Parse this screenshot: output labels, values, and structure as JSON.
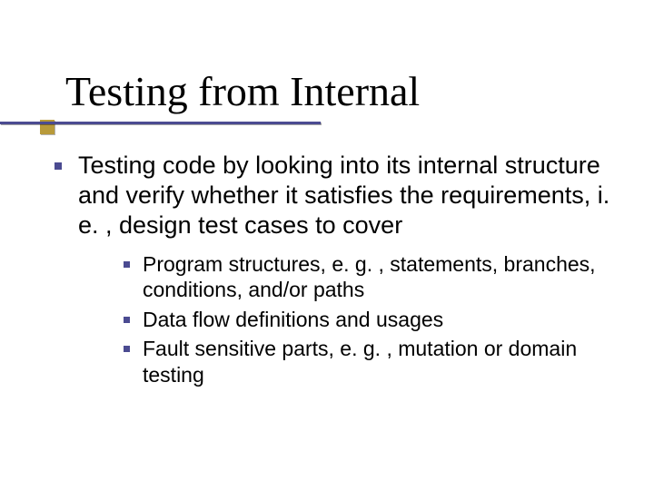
{
  "slide": {
    "title": "Testing from Internal",
    "bullets": [
      {
        "text": "Testing code by looking into its internal structure and verify whether it satisfies the requirements, i. e. , design test cases to cover",
        "children": [
          {
            "text": "Program structures, e. g. , statements, branches, conditions, and/or paths"
          },
          {
            "text": "Data flow definitions and usages"
          },
          {
            "text": "Fault sensitive parts, e. g. , mutation or domain testing"
          }
        ]
      }
    ]
  },
  "colors": {
    "accent_line": "#4b4b91",
    "accent_square": "#b89a3a"
  }
}
